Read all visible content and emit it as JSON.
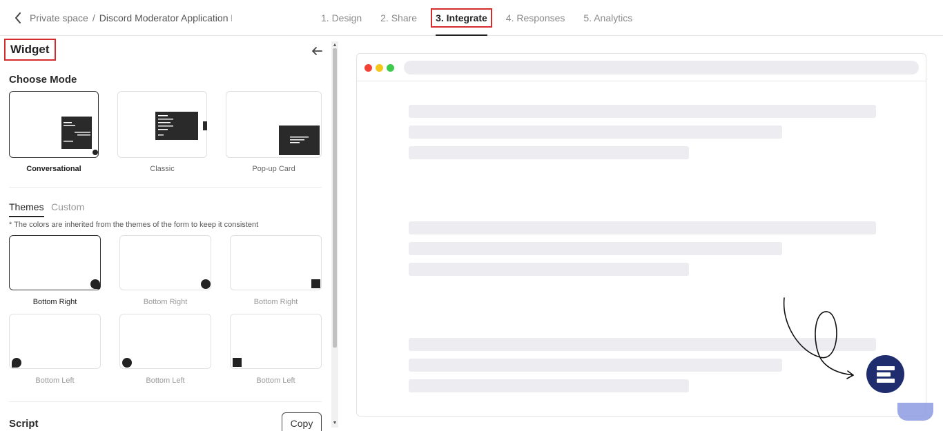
{
  "header": {
    "breadcrumb": {
      "parent": "Private space",
      "separator": "/",
      "current": "Discord Moderator Application Form"
    },
    "steps": [
      {
        "label": "1. Design",
        "active": false
      },
      {
        "label": "2. Share",
        "active": false
      },
      {
        "label": "3. Integrate",
        "active": true
      },
      {
        "label": "4. Responses",
        "active": false
      },
      {
        "label": "5. Analytics",
        "active": false
      }
    ]
  },
  "panel": {
    "title": "Widget",
    "choose_mode": {
      "title": "Choose Mode",
      "modes": [
        {
          "label": "Conversational",
          "selected": true
        },
        {
          "label": "Classic",
          "selected": false
        },
        {
          "label": "Pop-up Card",
          "selected": false
        }
      ]
    },
    "tabs": [
      {
        "label": "Themes",
        "active": true
      },
      {
        "label": "Custom",
        "active": false
      }
    ],
    "note": "* The colors are inherited from the themes of the form to keep it consistent",
    "themes": [
      {
        "label": "Bottom Right",
        "selected": true,
        "shape": "rounded"
      },
      {
        "label": "Bottom Right",
        "selected": false,
        "shape": "circle"
      },
      {
        "label": "Bottom Right",
        "selected": false,
        "shape": "square"
      },
      {
        "label": "Bottom Left",
        "selected": false,
        "shape": "rounded"
      },
      {
        "label": "Bottom Left",
        "selected": false,
        "shape": "circle"
      },
      {
        "label": "Bottom Left",
        "selected": false,
        "shape": "square"
      }
    ],
    "script": {
      "title": "Script",
      "copy_label": "Copy"
    }
  },
  "colors": {
    "highlight": "#d62b2b",
    "launcher": "#1f2d6e",
    "placeholder": "#ececf1",
    "traffic_red": "#f44336",
    "traffic_yellow": "#f5c518",
    "traffic_green": "#3ccb4a"
  }
}
